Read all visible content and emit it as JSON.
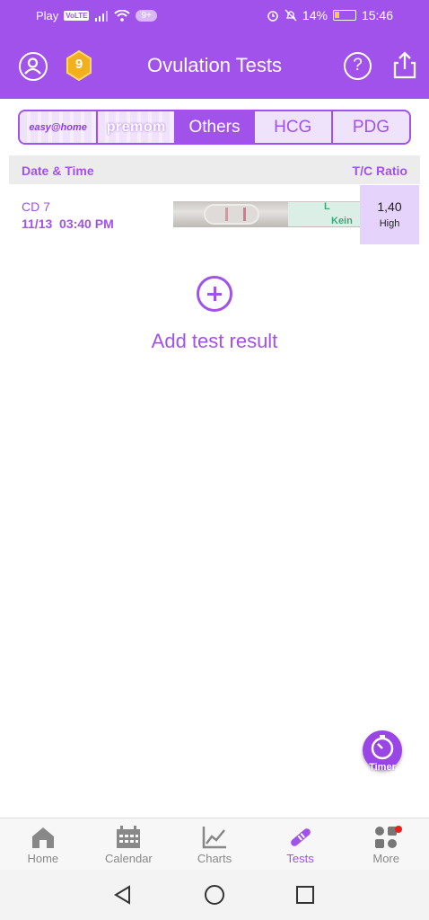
{
  "status_bar": {
    "carrier": "Play",
    "volte": "VoLTE",
    "notif_count": "9+",
    "battery": "14%",
    "time": "15:46"
  },
  "header": {
    "title": "Ovulation Tests",
    "coin_count": "9",
    "help_symbol": "?"
  },
  "brand_tabs": [
    {
      "label": "easy@home",
      "active": false
    },
    {
      "label": "premom",
      "active": false
    },
    {
      "label": "Others",
      "active": true
    },
    {
      "label": "HCG",
      "active": false
    },
    {
      "label": "PDG",
      "active": false
    }
  ],
  "table": {
    "col_left": "Date & Time",
    "col_right": "T/C Ratio",
    "rows": [
      {
        "cd": "CD 7",
        "datetime": "11/13  03:40 PM",
        "strip_text_top": "L",
        "strip_text_bottom": "Kein",
        "ratio": "1,40",
        "level": "High"
      }
    ]
  },
  "add_result": "Add test result",
  "timer_label": "Timer",
  "bottom_nav": [
    {
      "label": "Home",
      "icon": "home-icon",
      "active": false
    },
    {
      "label": "Calendar",
      "icon": "calendar-icon",
      "active": false
    },
    {
      "label": "Charts",
      "icon": "chart-icon",
      "active": false
    },
    {
      "label": "Tests",
      "icon": "test-strip-icon",
      "active": true
    },
    {
      "label": "More",
      "icon": "more-icon",
      "active": false
    }
  ],
  "colors": {
    "accent": "#a052ea",
    "ratio_bg": "#e6d3fb"
  }
}
